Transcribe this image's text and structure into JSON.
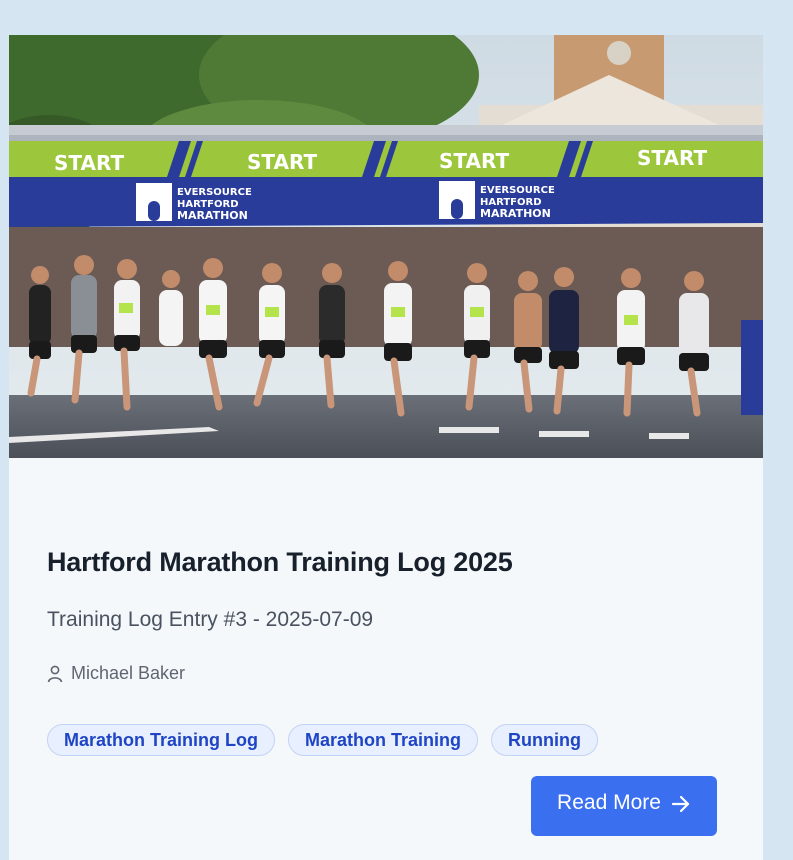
{
  "post": {
    "title": "Hartford Marathon Training Log 2025",
    "subtitle": "Training Log Entry #3 - 2025-07-09",
    "author": "Michael Baker",
    "author_icon": "user-icon",
    "tags": [
      "Marathon Training Log",
      "Marathon Training",
      "Running"
    ],
    "read_more_label": "Read More",
    "read_more_icon": "arrow-right-icon"
  },
  "hero_image": {
    "banner_word": "START",
    "sponsor_logo_text": [
      "EVERSOURCE",
      "HARTFORD",
      "MARATHON"
    ]
  },
  "colors": {
    "page_background": "#d5e5f1",
    "card_background": "#f5f8fb",
    "tag_background": "#e8f0ff",
    "tag_text": "#1f45c4",
    "button": "#3a6ff0",
    "banner_green": "#9cc63b",
    "banner_blue": "#2a3c9a"
  }
}
